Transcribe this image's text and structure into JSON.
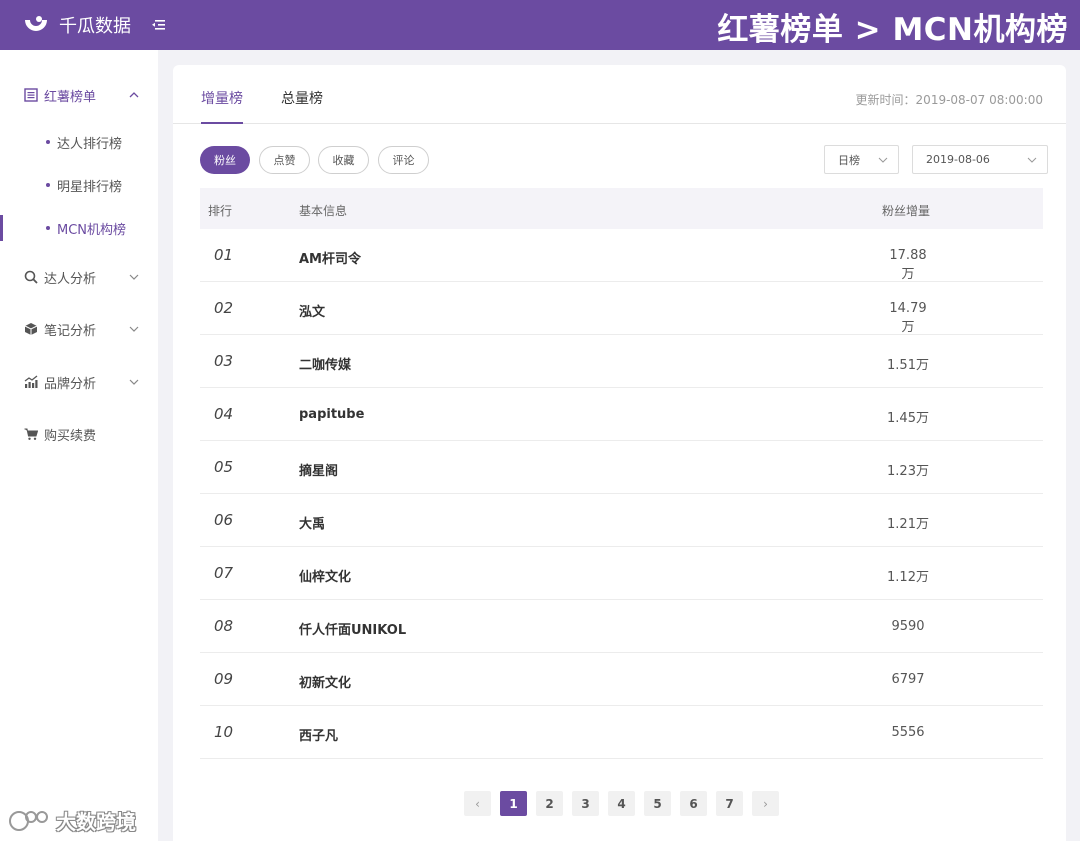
{
  "header": {
    "logo_text": "千瓜数据",
    "page_heading": "红薯榜单 > MCN机构榜"
  },
  "sidebar": {
    "groups": [
      {
        "label": "红薯榜单",
        "icon": "list-icon",
        "expanded": true
      },
      {
        "label": "达人分析",
        "icon": "search-icon",
        "expanded": false
      },
      {
        "label": "笔记分析",
        "icon": "cube-icon",
        "expanded": false
      },
      {
        "label": "品牌分析",
        "icon": "chart-icon",
        "expanded": false
      },
      {
        "label": "购买续费",
        "icon": "cart-icon",
        "expanded": false
      }
    ],
    "subitems": [
      {
        "label": "达人排行榜",
        "active": false
      },
      {
        "label": "明星排行榜",
        "active": false
      },
      {
        "label": "MCN机构榜",
        "active": true
      }
    ]
  },
  "watermark": {
    "text": "大数跨境"
  },
  "tabs": [
    {
      "label": "增量榜",
      "active": true
    },
    {
      "label": "总量榜",
      "active": false
    }
  ],
  "update_time": "更新时间：2019-08-07 08:00:00",
  "filters": [
    {
      "label": "粉丝",
      "active": true
    },
    {
      "label": "点赞",
      "active": false
    },
    {
      "label": "收藏",
      "active": false
    },
    {
      "label": "评论",
      "active": false
    }
  ],
  "period_select": {
    "value": "日榜"
  },
  "date_select": {
    "value": "2019-08-06"
  },
  "table": {
    "headers": [
      "排行",
      "基本信息",
      "粉丝增量"
    ],
    "rows": [
      {
        "rank": "01",
        "name": "AM杆司令",
        "value": "17.88万"
      },
      {
        "rank": "02",
        "name": "泓文",
        "value": "14.79万"
      },
      {
        "rank": "03",
        "name": "二咖传媒",
        "value": "1.51万"
      },
      {
        "rank": "04",
        "name": "papitube",
        "value": "1.45万"
      },
      {
        "rank": "05",
        "name": "摘星阁",
        "value": "1.23万"
      },
      {
        "rank": "06",
        "name": "大禹",
        "value": "1.21万"
      },
      {
        "rank": "07",
        "name": "仙梓文化",
        "value": "1.12万"
      },
      {
        "rank": "08",
        "name": "仟人仟面UNIKOL",
        "value": "9590"
      },
      {
        "rank": "09",
        "name": "初新文化",
        "value": "6797"
      },
      {
        "rank": "10",
        "name": "西子凡",
        "value": "5556"
      }
    ]
  },
  "pagination": {
    "prev": "‹",
    "next": "›",
    "pages": [
      "1",
      "2",
      "3",
      "4",
      "5",
      "6",
      "7"
    ],
    "current": "1"
  },
  "colors": {
    "brand": "#6b4ba1",
    "background": "#f2f2f6"
  }
}
